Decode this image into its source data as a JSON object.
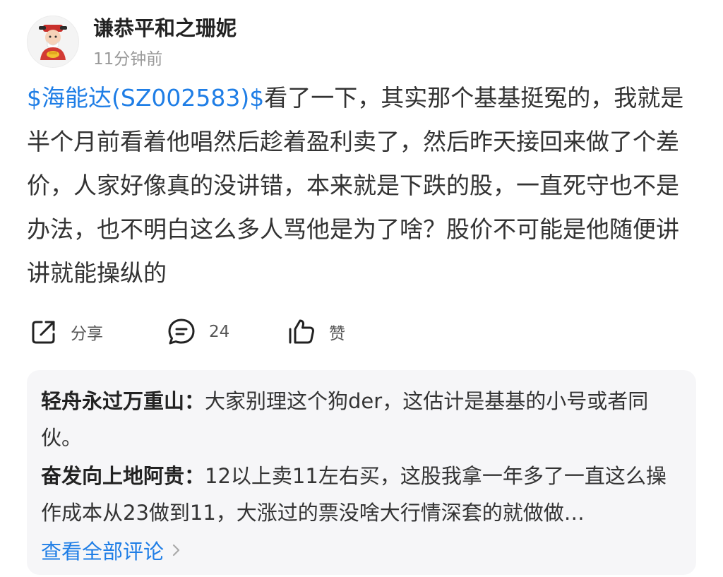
{
  "post": {
    "author": "谦恭平和之珊妮",
    "time": "11分钟前",
    "avatar_icon": "fortune-god-avatar",
    "stock_tag": "$海能达(SZ002583)$",
    "body_text": "看了一下，其实那个基基挺冤的，我就是半个月前看着他唱然后趁着盈利卖了，然后昨天接回来做了个差价，人家好像真的没讲错，本来就是下跌的股，一直死守也不是办法，也不明白这么多人骂他是为了啥？股价不可能是他随便讲讲就能操纵的"
  },
  "actions": {
    "share_label": "分享",
    "share_icon": "share-icon",
    "comment_count": "24",
    "comment_icon": "comment-icon",
    "like_label": "赞",
    "like_icon": "thumbs-up-icon"
  },
  "comments": {
    "items": [
      {
        "name": "轻舟永过万重山：",
        "text": "大家别理这个狗der，这估计是基基的小号或者同伙。"
      },
      {
        "name": "奋发向上地阿贵：",
        "text": "12以上卖11左右买，这股我拿一年多了一直这么操作成本从23做到11，大涨过的票没啥大行情深套的就做做…"
      }
    ],
    "view_all_label": "查看全部评论"
  },
  "colors": {
    "link_blue": "#1f7ee6",
    "body_text": "#333333",
    "muted": "#9a9a9a",
    "comment_bg": "#f6f6f8"
  }
}
